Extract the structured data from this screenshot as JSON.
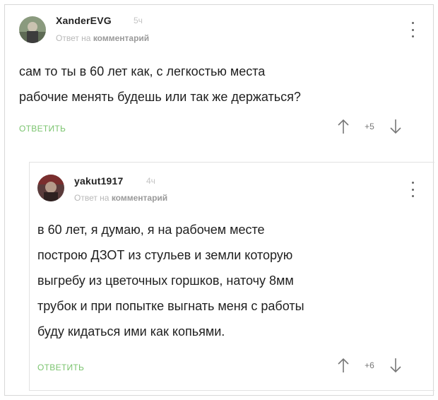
{
  "comments": [
    {
      "username": "XanderEVG",
      "time": "5ч",
      "reply_prefix": "Ответ на",
      "reply_target": "комментарий",
      "lines": [
        "сам то ты в 60 лет как, с легкостью места",
        "рабочие менять будешь или так же держаться?"
      ],
      "reply_label": "ОТВЕТИТЬ",
      "score": "+5",
      "icons": {
        "menu": "more-vertical-icon",
        "upvote": "arrow-up-icon",
        "downvote": "arrow-down-icon"
      }
    },
    {
      "username": "yakut1917",
      "time": "4ч",
      "reply_prefix": "Ответ на",
      "reply_target": "комментарий",
      "lines": [
        "в 60 лет, я думаю, я на рабочем месте",
        "построю ДЗОТ из стульев и земли которую",
        "выгребу из цветочных горшков, наточу 8мм",
        "трубок и при попытке выгнать меня с работы",
        "буду кидаться ими как копьями."
      ],
      "reply_label": "ОТВЕТИТЬ",
      "score": "+6",
      "icons": {
        "menu": "more-vertical-icon",
        "upvote": "arrow-up-icon",
        "downvote": "arrow-down-icon"
      }
    }
  ],
  "colors": {
    "reply_link": "#7bc46f",
    "meta_text": "#b8b8b8",
    "body_text": "#1f1f1f"
  }
}
